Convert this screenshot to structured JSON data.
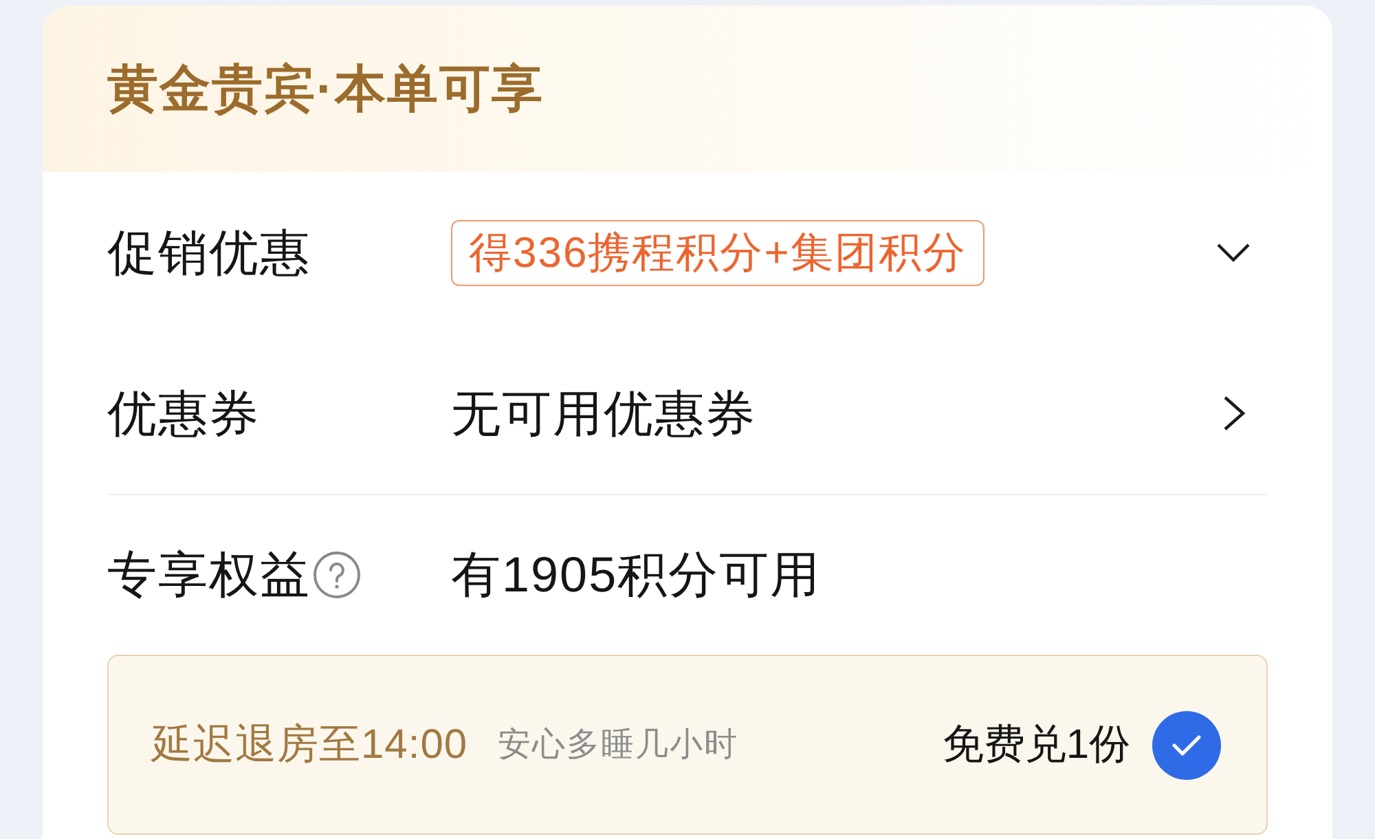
{
  "header": {
    "title": "黄金贵宾·本单可享"
  },
  "rows": [
    {
      "kind": "tag",
      "label": "促销优惠",
      "value": "得336携程积分+集团积分",
      "expanded": false
    },
    {
      "kind": "link",
      "label": "优惠券",
      "value": "无可用优惠券"
    },
    {
      "kind": "info",
      "label": "专享权益",
      "value": "有1905积分可用"
    }
  ],
  "benefit": {
    "title": "延迟退房至14:00",
    "subtitle": "安心多睡几小时",
    "price": "免费兑1份",
    "checked": true
  }
}
